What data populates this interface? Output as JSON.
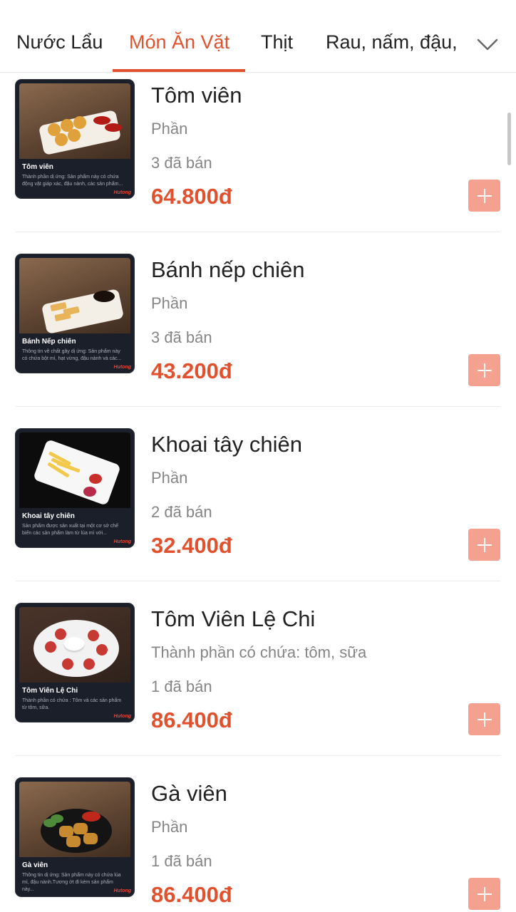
{
  "tabs": [
    {
      "label": "Nước Lẩu"
    },
    {
      "label": "Món Ăn Vặt"
    },
    {
      "label": "Thịt"
    },
    {
      "label": "Rau, nấm, đậu,r"
    }
  ],
  "active_tab": "Món Ăn Vặt",
  "icons": {
    "expand": "chevron-down-icon",
    "add": "plus-icon"
  },
  "colors": {
    "accent": "#e2512e",
    "add_button": "#f4a18f"
  },
  "items": [
    {
      "name": "Tôm viên",
      "desc": "Phần",
      "sold": "3 đã bán",
      "price": "64.800đ",
      "thumb_title": "Tôm viên",
      "thumb_desc": "Thành phần dị ứng: Sản phẩm này có chứa động vật giáp xác, đậu nành, các sản phẩm..."
    },
    {
      "name": "Bánh nếp chiên",
      "desc": "Phần",
      "sold": "3 đã bán",
      "price": "43.200đ",
      "thumb_title": "Bánh Nếp chiên",
      "thumb_desc": "Thông tin về chất gây dị ứng: Sản phẩm này có chứa bột mì, hạt vừng, đậu nành và các..."
    },
    {
      "name": "Khoai tây chiên",
      "desc": "Phần",
      "sold": "2 đã bán",
      "price": "32.400đ",
      "thumb_title": "Khoai tây chiên",
      "thumb_desc": "Sản phẩm được sản xuất tại một cơ sở chế biến các sản phẩm làm từ lúa mì với..."
    },
    {
      "name": "Tôm Viên Lệ Chi",
      "desc": "Thành phần có chứa: tôm, sữa",
      "sold": "1 đã bán",
      "price": "86.400đ",
      "thumb_title": "Tôm Viên Lệ Chi",
      "thumb_desc": "Thành phần có chứa : Tôm và các sản phẩm từ tôm, sữa."
    },
    {
      "name": "Gà viên",
      "desc": "Phần",
      "sold": "1 đã bán",
      "price": "86.400đ",
      "thumb_title": "Gà viên",
      "thumb_desc": "Thông tin dị ứng: Sản phẩm này có chứa lúa mì, đậu nành.Tương ớt đi kèm sản phẩm này..."
    }
  ]
}
